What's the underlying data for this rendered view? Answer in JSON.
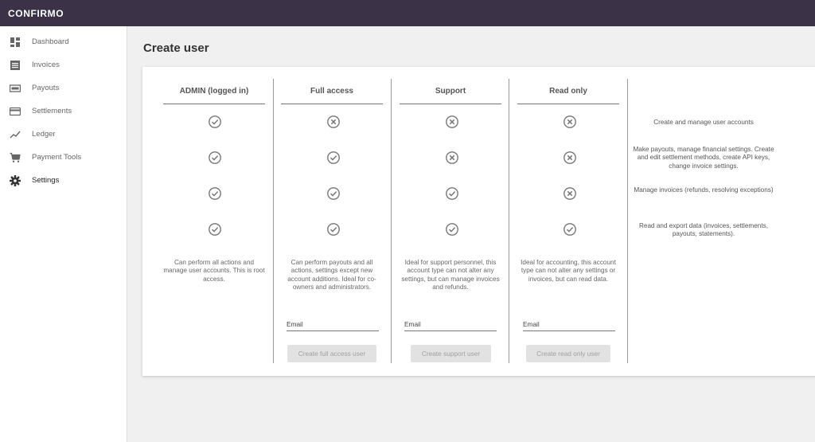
{
  "app": {
    "logo": "CONFIRMO"
  },
  "sidebar": {
    "items": [
      {
        "label": "Dashboard",
        "icon": "dashboard-icon"
      },
      {
        "label": "Invoices",
        "icon": "invoices-icon"
      },
      {
        "label": "Payouts",
        "icon": "payouts-icon"
      },
      {
        "label": "Settlements",
        "icon": "settlements-icon"
      },
      {
        "label": "Ledger",
        "icon": "ledger-icon"
      },
      {
        "label": "Payment Tools",
        "icon": "cart-icon"
      },
      {
        "label": "Settings",
        "icon": "gear-icon",
        "active": true
      }
    ]
  },
  "page": {
    "title": "Create user"
  },
  "columns": [
    {
      "title": "ADMIN (logged in)",
      "perms": [
        true,
        true,
        true,
        true
      ],
      "description": "Can perform all actions and manage user accounts. This is root access."
    },
    {
      "title": "Full access",
      "perms": [
        false,
        true,
        true,
        true
      ],
      "description": "Can perform payouts and all actions, settings except new account additions. Ideal for co-owners and administrators.",
      "email_label": "Email",
      "button": "Create full access user"
    },
    {
      "title": "Support",
      "perms": [
        false,
        false,
        true,
        true
      ],
      "description": "Ideal for support personnel, this account type can not alter any settings, but can manage invoices and refunds.",
      "email_label": "Email",
      "button": "Create support user"
    },
    {
      "title": "Read only",
      "perms": [
        false,
        false,
        false,
        true
      ],
      "description": "Ideal for accounting, this account type can not alter any settings or invoices, but can read data.",
      "email_label": "Email",
      "button": "Create read only user"
    }
  ],
  "permissions": [
    "Create and manage user accounts",
    "Make payouts, manage financial settings. Create and edit settlement methods, create API keys, change invoice settings.",
    "Manage invoices (refunds, resolving exceptions)",
    "Read and export data (invoices, settlements, payouts, statements)."
  ],
  "colors": {
    "topbar": "#3b3247",
    "icon": "#777777",
    "button_bg": "#e2e2e2",
    "button_text": "#a0a0a0"
  }
}
